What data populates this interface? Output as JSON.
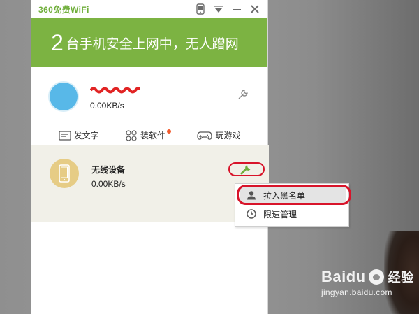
{
  "window": {
    "app_title": "360免费WiFi",
    "titlebar_icons": [
      "phone-icon",
      "dropdown-icon",
      "minimize-icon",
      "close-icon"
    ]
  },
  "banner": {
    "count": "2",
    "text": "台手机安全上网中，无人蹭网",
    "color": "#7cb342"
  },
  "hotspot": {
    "name_redacted": "~~~~~~~~",
    "speed": "0.00KB/s"
  },
  "actions": [
    {
      "label": "发文字",
      "icon": "message-icon"
    },
    {
      "label": "装软件",
      "icon": "apps-icon",
      "badge": true
    },
    {
      "label": "玩游戏",
      "icon": "gamepad-icon"
    }
  ],
  "device": {
    "name": "无线设备",
    "speed": "0.00KB/s"
  },
  "context_menu": {
    "items": [
      {
        "label": "拉入黑名单",
        "icon": "user-icon"
      },
      {
        "label": "限速管理",
        "icon": "clock-icon"
      }
    ]
  },
  "watermark": {
    "brand": "Baidu",
    "suffix": "经验",
    "url": "jingyan.baidu.com"
  },
  "colors": {
    "accent": "#6fae3a",
    "highlight": "#d8142a"
  }
}
